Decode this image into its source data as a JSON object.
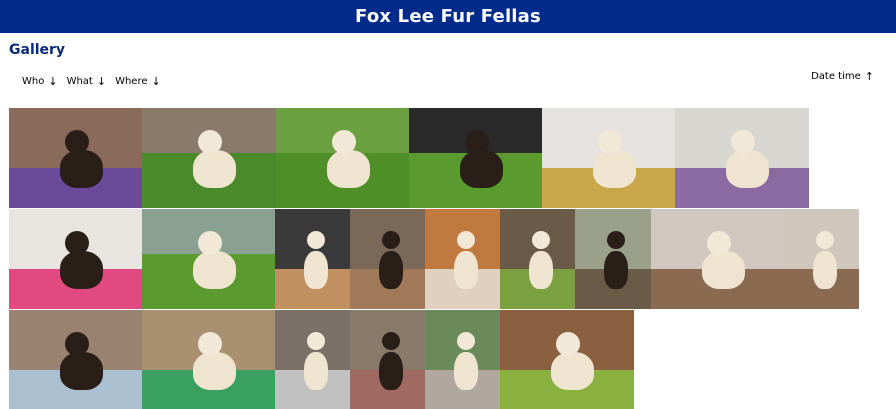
{
  "site": {
    "title": "Fox Lee Fur Fellas"
  },
  "gallery": {
    "heading": "Gallery"
  },
  "filters": [
    {
      "label": "Who",
      "arrow": "↓"
    },
    {
      "label": "What",
      "arrow": "↓"
    },
    {
      "label": "Where",
      "arrow": "↓"
    }
  ],
  "sort": {
    "label": "Date time",
    "arrow": "↑"
  },
  "colors": {
    "header_bg": "#002b8a",
    "heading_text": "#0a2a7a"
  },
  "photos": [
    {
      "scene": "living-room",
      "bg": "#8a6a5a",
      "accent": "#6b4a9a"
    },
    {
      "scene": "yard",
      "bg": "#8a7a6a",
      "accent": "#4a8a2a"
    },
    {
      "scene": "yard",
      "bg": "#6aa040",
      "accent": "#4f8f28"
    },
    {
      "scene": "yard",
      "bg": "#2a2a2a",
      "accent": "#5a9a2e"
    },
    {
      "scene": "birthday",
      "bg": "#e6e2e0",
      "accent": "#c9a64a"
    },
    {
      "scene": "indoor",
      "bg": "#d8d6d0",
      "accent": "#8a6aa0"
    },
    {
      "scene": "birthday",
      "bg": "#e8e4e0",
      "accent": "#e04a80"
    },
    {
      "scene": "yard",
      "bg": "#8aa090",
      "accent": "#5a9a2e"
    },
    {
      "scene": "car",
      "bg": "#3a3a3a",
      "accent": "#c09060"
    },
    {
      "scene": "floor",
      "bg": "#7a6858",
      "accent": "#a07a58"
    },
    {
      "scene": "door",
      "bg": "#c07a40",
      "accent": "#e0d0c0"
    },
    {
      "scene": "floor",
      "bg": "#6a5a48",
      "accent": "#7aa040"
    },
    {
      "scene": "window",
      "bg": "#9aa08a",
      "accent": "#6a5a48"
    },
    {
      "scene": "floor",
      "bg": "#d0c8c0",
      "accent": "#8a6a50"
    },
    {
      "scene": "floor",
      "bg": "#cfc6bc",
      "accent": "#8a6a50"
    },
    {
      "scene": "floor",
      "bg": "#9a8270",
      "accent": "#aac0d0"
    },
    {
      "scene": "sand",
      "bg": "#a89070",
      "accent": "#3aa060"
    },
    {
      "scene": "window",
      "bg": "#7a7068",
      "accent": "#c0c0c0"
    },
    {
      "scene": "window",
      "bg": "#8a7a6a",
      "accent": "#a06a60"
    },
    {
      "scene": "patio",
      "bg": "#6a8a5a",
      "accent": "#b0a8a0"
    },
    {
      "scene": "floor",
      "bg": "#8a6040",
      "accent": "#8ab040"
    }
  ]
}
